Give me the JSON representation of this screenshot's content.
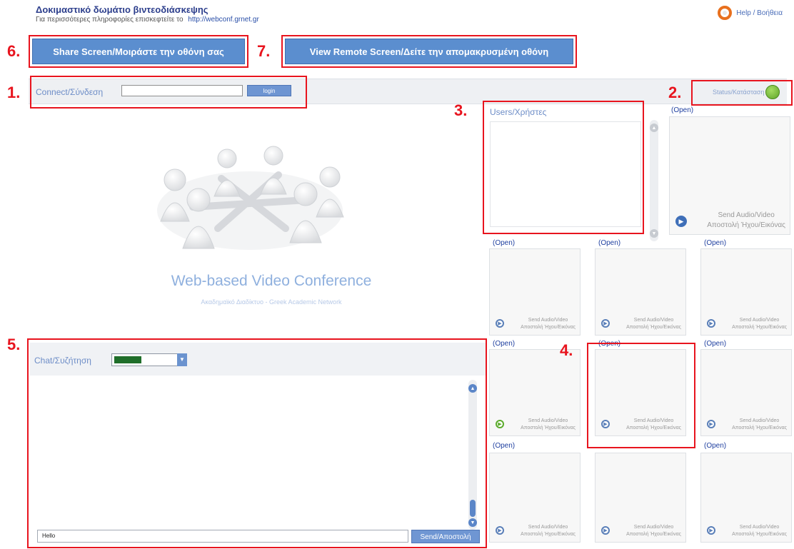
{
  "header": {
    "title": "Δοκιμαστικό δωμάτιο βιντεοδιάσκεψης",
    "subtitle": "Για περισσότερες πληροφορίες επισκεφτείτε το",
    "link": "http://webconf.grnet.gr",
    "help": "Help / Βοήθεια"
  },
  "annotations": [
    "6.",
    "7.",
    "1.",
    "2.",
    "3.",
    "4.",
    "5."
  ],
  "toolbar": {
    "share_label": "Share Screen/Μοιράστε την οθόνη σας",
    "view_label": "View Remote Screen/Δείτε την απομακρυσμένη οθόνη"
  },
  "connect": {
    "label": "Connect/Σύνδεση",
    "input_value": "",
    "login_label": "login"
  },
  "status": {
    "label": "Status/Κατάσταση",
    "color": "#6cc43a"
  },
  "users": {
    "title": "Users/Χρήστες"
  },
  "video": {
    "open_label": "(Open)",
    "send_line1": "Send Audio/Video",
    "send_line2": "Αποστολή Ήχου/Εικόνας"
  },
  "logo": {
    "title": "Web-based Video Conference",
    "subtitle": "Ακαδημαϊκό Διαδίκτυο - Greek Academic Network"
  },
  "chat": {
    "label": "Chat/Συζήτηση",
    "color_value": "#1f6e2a",
    "input_value": "Hello",
    "send_label": "Send/Αποστολή"
  },
  "colors": {
    "accent": "#5b8ecf",
    "annotation": "#e8141e"
  }
}
